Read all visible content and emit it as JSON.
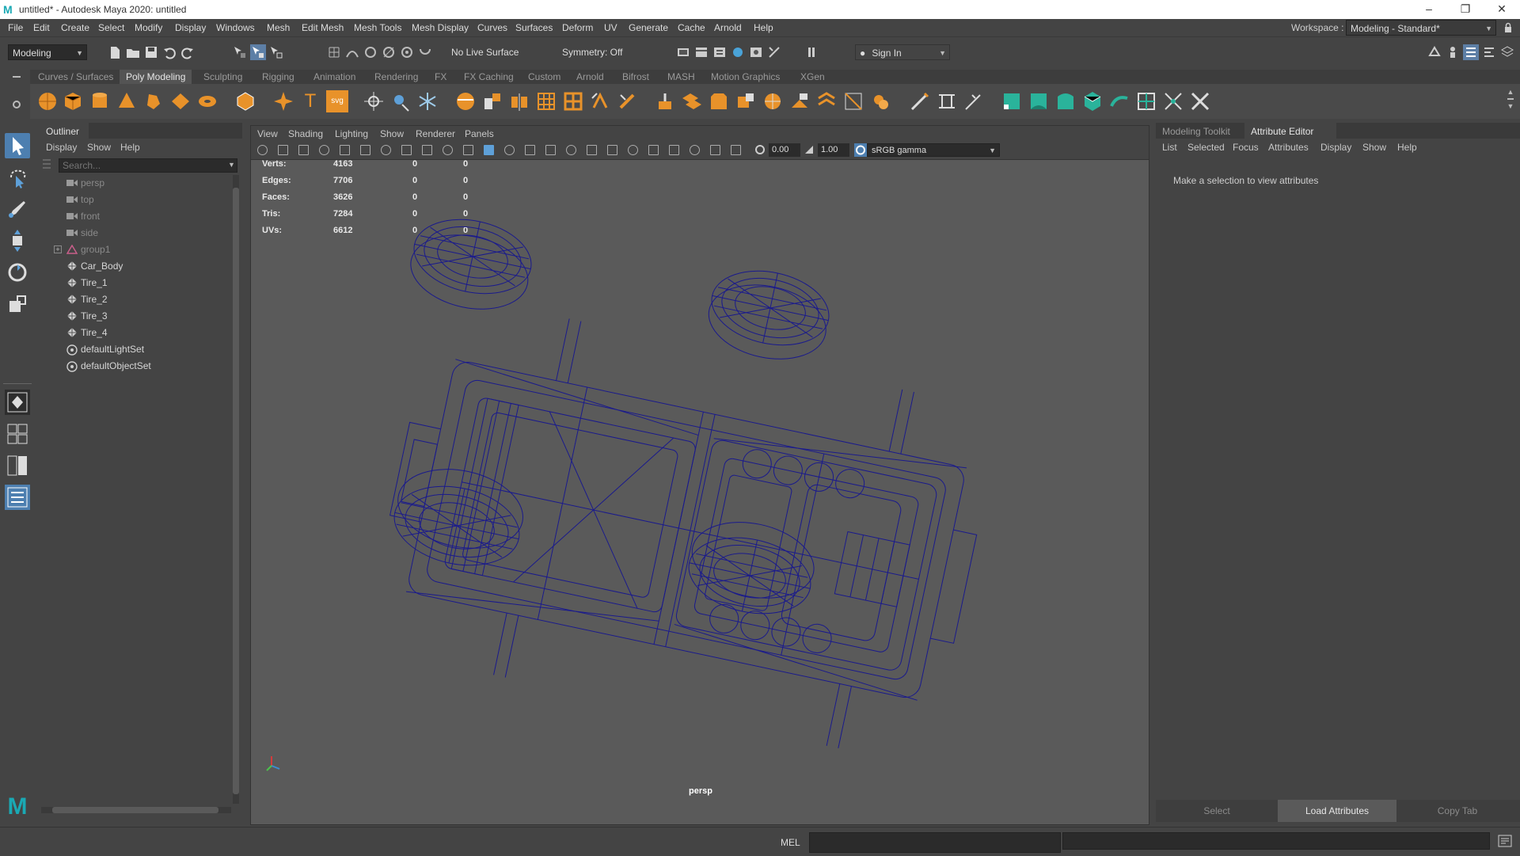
{
  "window": {
    "title": "untitled* - Autodesk Maya 2020: untitled",
    "logo_letter": "M",
    "minimize": "–",
    "restore": "❐",
    "close": "✕"
  },
  "menubar": {
    "items": [
      "File",
      "Edit",
      "Create",
      "Select",
      "Modify",
      "Display",
      "Windows",
      "Mesh",
      "Edit Mesh",
      "Mesh Tools",
      "Mesh Display",
      "Curves",
      "Surfaces",
      "Deform",
      "UV",
      "Generate",
      "Cache",
      "Arnold",
      "Help"
    ],
    "workspace_label": "Workspace :",
    "workspace_value": "Modeling - Standard*"
  },
  "statusline": {
    "mode": "Modeling",
    "live_surface": "No Live Surface",
    "symmetry": "Symmetry: Off",
    "sign_in": "Sign In"
  },
  "shelf": {
    "tabs": [
      "Curves / Surfaces",
      "Poly Modeling",
      "Sculpting",
      "Rigging",
      "Animation",
      "Rendering",
      "FX",
      "FX Caching",
      "Custom",
      "Arnold",
      "Bifrost",
      "MASH",
      "Motion Graphics",
      "XGen"
    ],
    "active_tab": "Poly Modeling",
    "text_icon": "T",
    "svg_icon": "svg"
  },
  "outliner": {
    "title": "Outliner",
    "menu": [
      "Display",
      "Show",
      "Help"
    ],
    "search_placeholder": "Search...",
    "items": [
      {
        "label": "persp",
        "type": "camera",
        "dim": true
      },
      {
        "label": "top",
        "type": "camera",
        "dim": true
      },
      {
        "label": "front",
        "type": "camera",
        "dim": true
      },
      {
        "label": "side",
        "type": "camera",
        "dim": true
      },
      {
        "label": "group1",
        "type": "group",
        "dim": true
      },
      {
        "label": "Car_Body",
        "type": "mesh",
        "dim": false
      },
      {
        "label": "Tire_1",
        "type": "mesh",
        "dim": false
      },
      {
        "label": "Tire_2",
        "type": "mesh",
        "dim": false
      },
      {
        "label": "Tire_3",
        "type": "mesh",
        "dim": false
      },
      {
        "label": "Tire_4",
        "type": "mesh",
        "dim": false
      },
      {
        "label": "defaultLightSet",
        "type": "set",
        "dim": false
      },
      {
        "label": "defaultObjectSet",
        "type": "set",
        "dim": false
      }
    ]
  },
  "viewport": {
    "menu": [
      "View",
      "Shading",
      "Lighting",
      "Show",
      "Renderer",
      "Panels"
    ],
    "exposure": "0.00",
    "gamma": "1.00",
    "color_space": "sRGB gamma",
    "camera_label": "persp",
    "hud": [
      {
        "label": "Verts:",
        "a": "4163",
        "b": "0",
        "c": "0"
      },
      {
        "label": "Edges:",
        "a": "7706",
        "b": "0",
        "c": "0"
      },
      {
        "label": "Faces:",
        "a": "3626",
        "b": "0",
        "c": "0"
      },
      {
        "label": "Tris:",
        "a": "7284",
        "b": "0",
        "c": "0"
      },
      {
        "label": "UVs:",
        "a": "6612",
        "b": "0",
        "c": "0"
      }
    ],
    "wire_color": "#1a1a8c"
  },
  "attribute_editor": {
    "tabs": [
      "Modeling Toolkit",
      "Attribute Editor"
    ],
    "active_tab": "Attribute Editor",
    "menu": [
      "List",
      "Selected",
      "Focus",
      "Attributes",
      "Display",
      "Show",
      "Help"
    ],
    "empty_message": "Make a selection to view attributes",
    "buttons": [
      "Select",
      "Load Attributes",
      "Copy Tab"
    ]
  },
  "cmdline": {
    "language": "MEL"
  },
  "colors": {
    "accent_orange": "#e8922a",
    "accent_teal": "#2ab39b",
    "accent_blue": "#5ea0d8",
    "selected_blue": "#4d7fb0"
  }
}
